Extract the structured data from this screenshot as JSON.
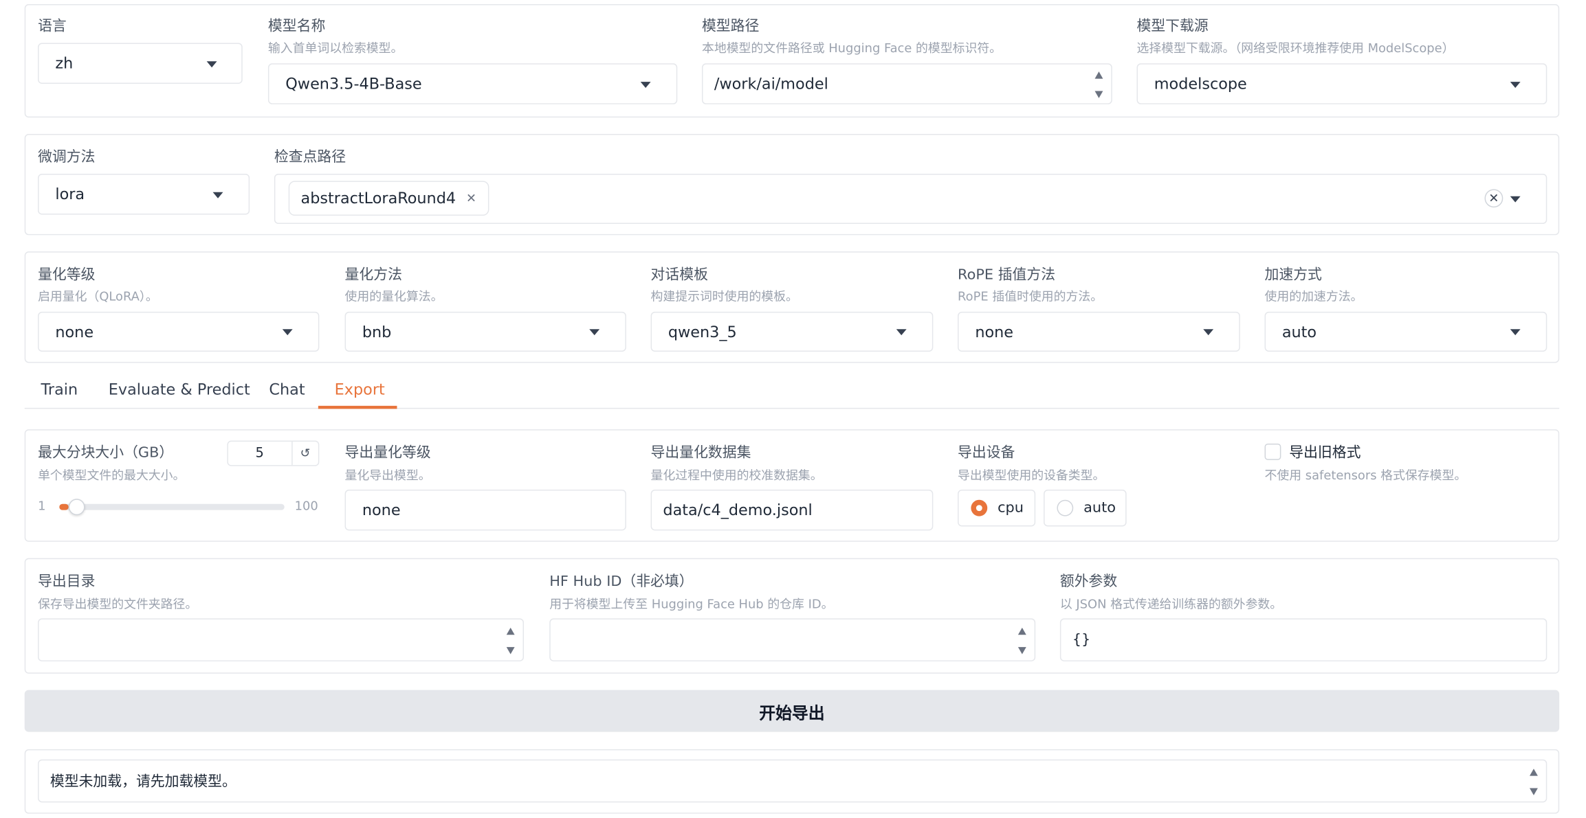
{
  "top": {
    "lang": {
      "label": "语言",
      "value": "zh"
    },
    "model_name": {
      "label": "模型名称",
      "info": "输入首单词以检索模型。",
      "value": "Qwen3.5-4B-Base"
    },
    "model_path": {
      "label": "模型路径",
      "info": "本地模型的文件路径或 Hugging Face 的模型标识符。",
      "value": "/work/ai/model"
    },
    "hub": {
      "label": "模型下载源",
      "info": "选择模型下载源。（网络受限环境推荐使用 ModelScope）",
      "value": "modelscope"
    }
  },
  "finetune": {
    "method": {
      "label": "微调方法",
      "value": "lora"
    },
    "checkpoint": {
      "label": "检查点路径",
      "chips": [
        "abstractLoraRound4"
      ]
    }
  },
  "advanced": {
    "quant_bit": {
      "label": "量化等级",
      "info": "启用量化（QLoRA）。",
      "value": "none"
    },
    "quant_method": {
      "label": "量化方法",
      "info": "使用的量化算法。",
      "value": "bnb"
    },
    "template": {
      "label": "对话模板",
      "info": "构建提示词时使用的模板。",
      "value": "qwen3_5"
    },
    "rope": {
      "label": "RoPE 插值方法",
      "info": "RoPE 插值时使用的方法。",
      "value": "none"
    },
    "booster": {
      "label": "加速方式",
      "info": "使用的加速方法。",
      "value": "auto"
    }
  },
  "tabs": [
    "Train",
    "Evaluate & Predict",
    "Chat",
    "Export"
  ],
  "active_tab": "Export",
  "export": {
    "size": {
      "label": "最大分块大小（GB）",
      "info": "单个模型文件的最大大小。",
      "value": "5",
      "min": "1",
      "max": "100",
      "level": 0.04
    },
    "quant_bit": {
      "label": "导出量化等级",
      "info": "量化导出模型。",
      "value": "none"
    },
    "dataset": {
      "label": "导出量化数据集",
      "info": "量化过程中使用的校准数据集。",
      "value": "data/c4_demo.jsonl"
    },
    "device": {
      "label": "导出设备",
      "info": "导出模型使用的设备类型。",
      "options": [
        "cpu",
        "auto"
      ],
      "selected": "cpu"
    },
    "legacy": {
      "label": "导出旧格式",
      "info": "不使用 safetensors 格式保存模型。",
      "checked": false
    },
    "dir": {
      "label": "导出目录",
      "info": "保存导出模型的文件夹路径。",
      "value": ""
    },
    "hub_id": {
      "label": "HF Hub ID（非必填）",
      "info": "用于将模型上传至 Hugging Face Hub 的仓库 ID。",
      "value": ""
    },
    "extra": {
      "label": "额外参数",
      "info": "以 JSON 格式传递给训练器的额外参数。",
      "value": "{}"
    },
    "button": "开始导出",
    "output": "模型未加载，请先加载模型。"
  },
  "colors": {
    "accent": "#e8743b",
    "border": "#e5e7eb",
    "button_bg": "#e5e7eb"
  },
  "icons": [
    "chevron-down-icon",
    "spinner-up-icon",
    "spinner-down-icon",
    "close-icon",
    "reset-icon"
  ]
}
